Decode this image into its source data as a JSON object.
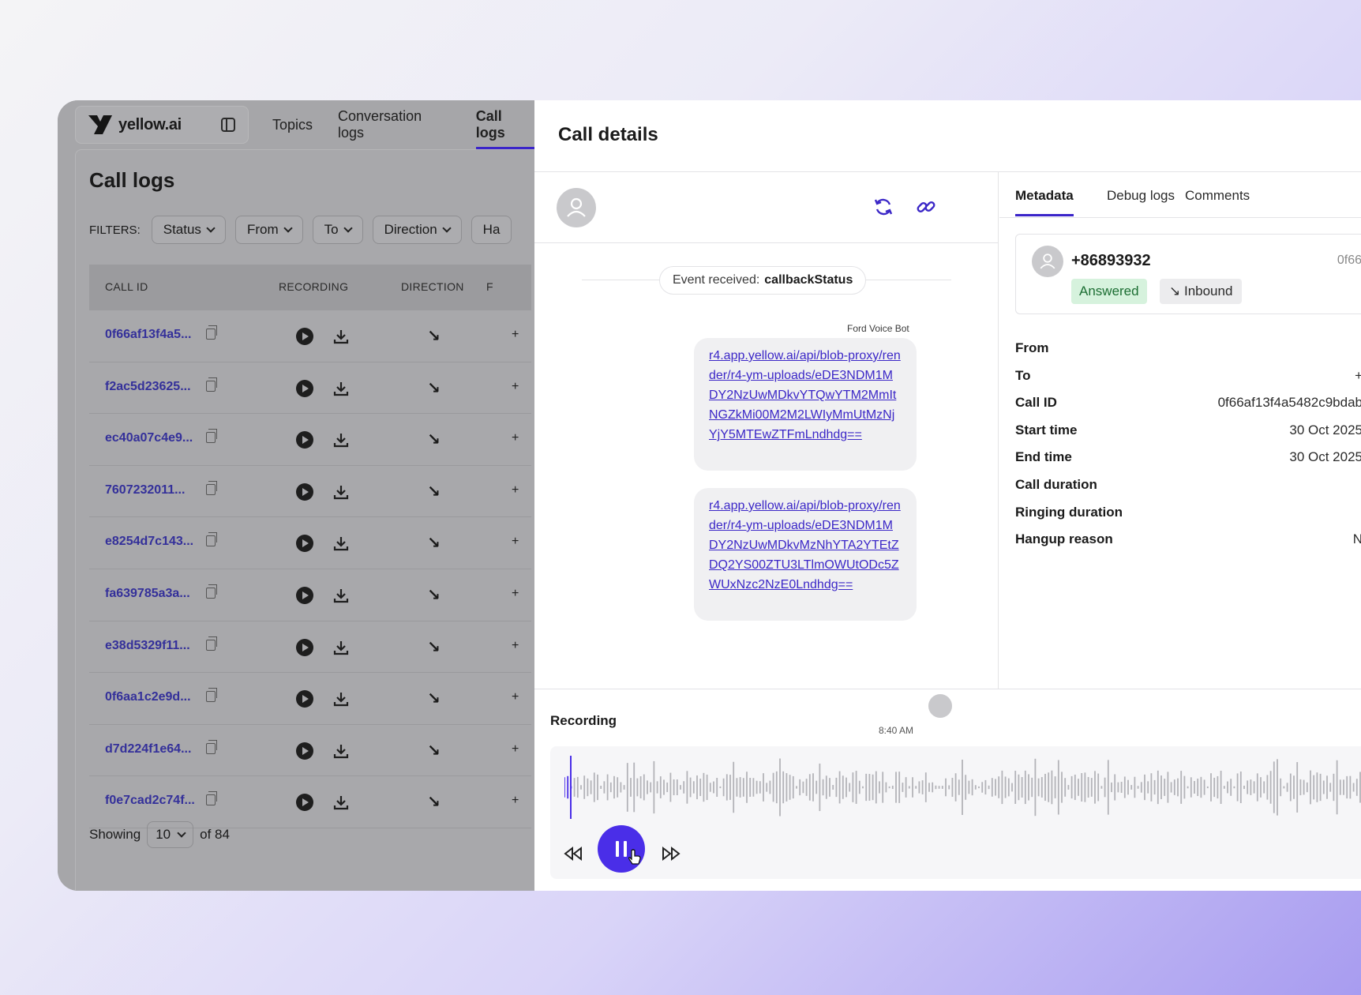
{
  "brand": {
    "name": "yellow.ai"
  },
  "topnav": {
    "tabs": [
      "Topics",
      "Conversation logs",
      "Call logs"
    ],
    "active": "Call logs"
  },
  "page": {
    "title": "Call logs"
  },
  "filters": {
    "label": "FILTERS:",
    "chips": [
      "Status",
      "From",
      "To",
      "Direction",
      "Ha"
    ]
  },
  "table": {
    "headers": {
      "call_id": "CALL ID",
      "recording": "RECORDING",
      "direction": "DIRECTION",
      "extra": "F"
    },
    "rows": [
      {
        "id": "0f66af13f4a5...",
        "more": "+"
      },
      {
        "id": "f2ac5d23625...",
        "more": "+"
      },
      {
        "id": "ec40a07c4e9...",
        "more": "+"
      },
      {
        "id": "7607232011...",
        "more": "+"
      },
      {
        "id": "e8254d7c143...",
        "more": "+"
      },
      {
        "id": "fa639785a3a...",
        "more": "+"
      },
      {
        "id": "e38d5329f11...",
        "more": "+"
      },
      {
        "id": "0f6aa1c2e9d...",
        "more": "+"
      },
      {
        "id": "d7d224f1e64...",
        "more": "+"
      },
      {
        "id": "f0e7cad2c74f...",
        "more": "+"
      }
    ],
    "direction_glyph": "↘"
  },
  "pager": {
    "showing": "Showing",
    "page_size": "10",
    "of_total": "of 84"
  },
  "drawer": {
    "title": "Call details",
    "event": {
      "prefix": "Event received:",
      "name": "callbackStatus"
    },
    "bot_name": "Ford Voice Bot",
    "messages": [
      "r4.app.yellow.ai/api/blob-proxy/render/r4-ym-uploads/eDE3NDM1MDY2NzUwMDkvYTQwYTM2MmItNGZkMi00M2M2LWIyMmUtMzNjYjY5MTEwZTFmLndhdg==",
      "r4.app.yellow.ai/api/blob-proxy/render/r4-ym-uploads/eDE3NDM1MDY2NzUwMDkvMzNhYTA2YTEtZDQ2YS00ZTU3LTlmOWUtODc5ZWUxNzc2NzE0Lndhdg=="
    ],
    "message_time": "8:40 AM"
  },
  "meta": {
    "tabs": [
      "Metadata",
      "Debug logs",
      "Comments"
    ],
    "active_tab": "Metadata",
    "contact": {
      "number": "+86893932",
      "trunc_id": "0f66",
      "status": "Answered",
      "direction": "↘ Inbound"
    },
    "fields": [
      {
        "key": "From",
        "value": ""
      },
      {
        "key": "To",
        "value": "+"
      },
      {
        "key": "Call ID",
        "value": "0f66af13f4a5482c9bdab"
      },
      {
        "key": "Start time",
        "value": "30 Oct 2025"
      },
      {
        "key": "End time",
        "value": "30 Oct 2025"
      },
      {
        "key": "Call duration",
        "value": ""
      },
      {
        "key": "Ringing duration",
        "value": ""
      },
      {
        "key": "Hangup reason",
        "value": "N"
      }
    ]
  },
  "recording": {
    "title": "Recording"
  },
  "colors": {
    "accent": "#3a24c9",
    "play_button": "#4a2ee8",
    "link": "#3b27c7"
  }
}
